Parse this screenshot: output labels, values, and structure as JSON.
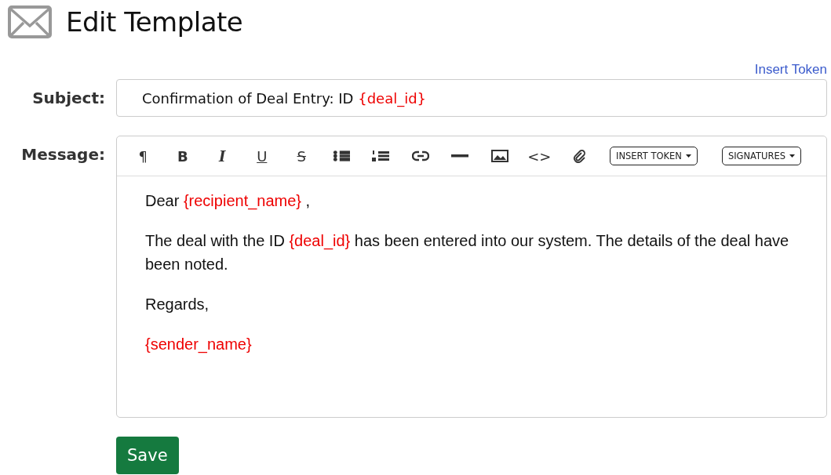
{
  "page": {
    "title": "Edit Template"
  },
  "insert_token_link": "Insert Token",
  "subject": {
    "label": "Subject:",
    "segments": [
      {
        "text": "Confirmation of Deal Entry: ID ",
        "kind": "plain"
      },
      {
        "text": "{deal_id}",
        "kind": "token"
      }
    ]
  },
  "message": {
    "label": "Message:",
    "toolbar": [
      {
        "kind": "glyph",
        "label": "¶"
      },
      {
        "kind": "glyph",
        "label": "B"
      },
      {
        "kind": "glyph",
        "label": "I"
      },
      {
        "kind": "glyph",
        "label": "U"
      },
      {
        "kind": "glyph",
        "label": "S"
      },
      {
        "kind": "icon"
      },
      {
        "kind": "icon"
      },
      {
        "kind": "icon"
      },
      {
        "kind": "icon"
      },
      {
        "kind": "icon"
      },
      {
        "kind": "glyph",
        "label": "<>"
      },
      {
        "kind": "icon"
      },
      {
        "kind": "dropdown",
        "label": "INSERT TOKEN"
      },
      {
        "kind": "dropdown",
        "label": "SIGNATURES"
      }
    ],
    "paragraphs": [
      [
        {
          "text": "Dear ",
          "kind": "plain"
        },
        {
          "text": "{recipient_name}",
          "kind": "token"
        },
        {
          "text": " ,",
          "kind": "plain"
        }
      ],
      [
        {
          "text": "The deal with the ID ",
          "kind": "plain"
        },
        {
          "text": "{deal_id}",
          "kind": "token"
        },
        {
          "text": " has been entered into our system. The details of the deal have been noted.",
          "kind": "plain"
        }
      ],
      [
        {
          "text": "Regards,",
          "kind": "plain"
        }
      ],
      [
        {
          "text": "{sender_name}",
          "kind": "token"
        }
      ]
    ]
  },
  "save_button": "Save"
}
